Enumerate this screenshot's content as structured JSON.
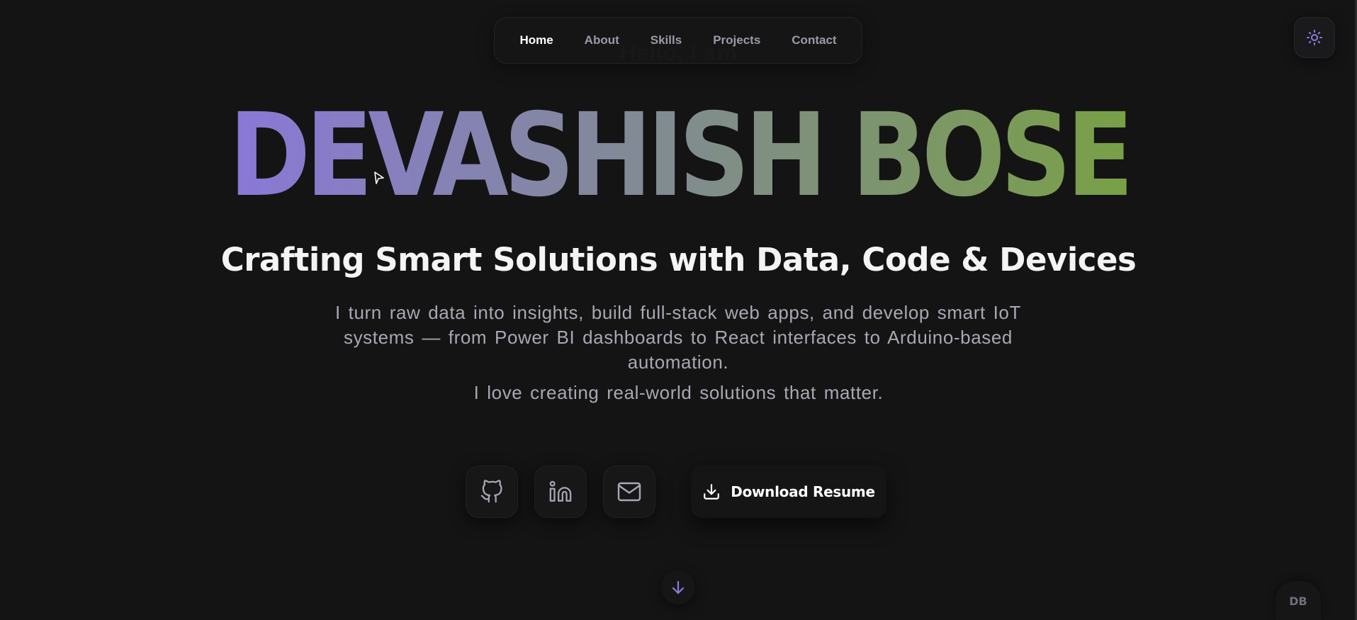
{
  "greeting": "Hello, I am",
  "nav": {
    "items": [
      {
        "label": "Home",
        "active": true
      },
      {
        "label": "About",
        "active": false
      },
      {
        "label": "Skills",
        "active": false
      },
      {
        "label": "Projects",
        "active": false
      },
      {
        "label": "Contact",
        "active": false
      }
    ]
  },
  "theme_toggle": {
    "icon": "sun-icon"
  },
  "hero": {
    "name": "DEVASHISH BOSE",
    "gradient_start": "#8a78d8",
    "gradient_end": "#78a046",
    "tagline": "Crafting Smart Solutions with Data, Code & Devices",
    "intro": "I turn raw data into insights, build full-stack web apps, and develop smart IoT systems — from Power BI dashboards to React interfaces to Arduino-based automation.",
    "intro2": "I love creating real-world solutions that matter."
  },
  "socials": [
    {
      "name": "github",
      "icon": "github-icon"
    },
    {
      "name": "linkedin",
      "icon": "linkedin-icon"
    },
    {
      "name": "mail",
      "icon": "mail-icon"
    }
  ],
  "resume_button": {
    "label": "Download Resume",
    "icon": "download-icon"
  },
  "scroll_down": {
    "icon": "arrow-down-icon"
  },
  "badge": {
    "label": "DB"
  },
  "colors": {
    "background": "#141414",
    "accent": "#8b7ce0"
  }
}
